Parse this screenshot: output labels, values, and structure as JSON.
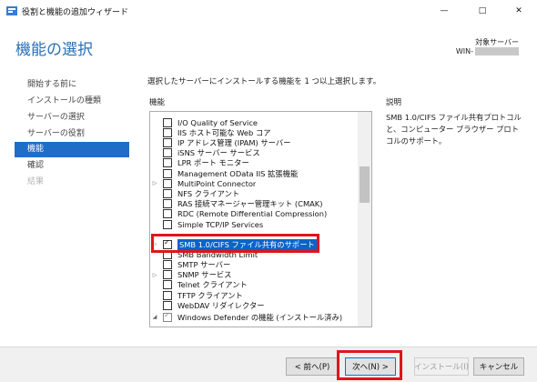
{
  "window": {
    "title": "役割と機能の追加ウィザード",
    "minimize_glyph": "—",
    "maximize_glyph": "□",
    "close_glyph": "✕"
  },
  "header": {
    "title": "機能の選択",
    "server_label": "対象サーバー",
    "server_name": "WIN-"
  },
  "nav": [
    {
      "label": "開始する前に"
    },
    {
      "label": "インストールの種類"
    },
    {
      "label": "サーバーの選択"
    },
    {
      "label": "サーバーの役割"
    },
    {
      "label": "機能"
    },
    {
      "label": "確認"
    },
    {
      "label": "結果"
    }
  ],
  "instruction": "選択したサーバーにインストールする機能を 1 つ以上選択します。",
  "features_label": "機能",
  "description_label": "説明",
  "features": [
    {
      "label": "I/O Quality of Service",
      "checked": false,
      "expander": false
    },
    {
      "label": "IIS ホスト可能な Web コア",
      "checked": false,
      "expander": false
    },
    {
      "label": "IP アドレス管理 (IPAM) サーバー",
      "checked": false,
      "expander": false
    },
    {
      "label": "iSNS サーバー サービス",
      "checked": false,
      "expander": false
    },
    {
      "label": "LPR ポート モニター",
      "checked": false,
      "expander": false
    },
    {
      "label": "Management OData IIS 拡張機能",
      "checked": false,
      "expander": false
    },
    {
      "label": "MultiPoint Connector",
      "checked": false,
      "expander": true
    },
    {
      "label": "NFS クライアント",
      "checked": false,
      "expander": false
    },
    {
      "label": "RAS 接続マネージャー管理キット (CMAK)",
      "checked": false,
      "expander": false
    },
    {
      "label": "RDC (Remote Differential Compression)",
      "checked": false,
      "expander": false
    },
    {
      "label": "Simple TCP/IP Services",
      "checked": false,
      "expander": false
    },
    {
      "label": "SMB 1.0/CIFS ファイル共有のサポート",
      "checked": true,
      "expander": true,
      "selected": true
    },
    {
      "label": "SMB Bandwidth Limit",
      "checked": false,
      "expander": false
    },
    {
      "label": "SMTP サーバー",
      "checked": false,
      "expander": false
    },
    {
      "label": "SNMP サービス",
      "checked": false,
      "expander": true
    },
    {
      "label": "Telnet クライアント",
      "checked": false,
      "expander": false
    },
    {
      "label": "TFTP クライアント",
      "checked": false,
      "expander": false
    },
    {
      "label": "WebDAV リダイレクター",
      "checked": false,
      "expander": false
    },
    {
      "label": "Windows Defender の機能 (インストール済み)",
      "checked": "partial",
      "expander": true,
      "expanded": true
    }
  ],
  "description": "SMB 1.0/CIFS ファイル共有プロトコルと、コンピューター ブラウザー プロトコルのサポート。",
  "buttons": {
    "previous": "< 前へ(P)",
    "next": "次へ(N) >",
    "install": "インストール(I)",
    "cancel": "キャンセル"
  },
  "colors": {
    "accent": "#1e6ec8",
    "heading": "#2b6fb8",
    "annotation_red": "#e0141e"
  }
}
